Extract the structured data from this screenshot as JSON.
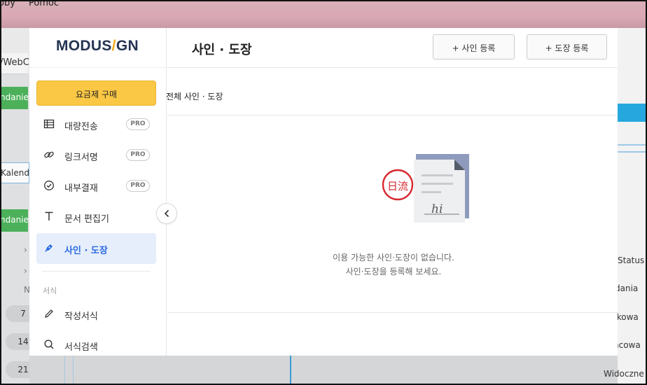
{
  "background": {
    "menu_items": [
      "oby",
      "Pomoc"
    ],
    "url_fragment": "/WebC",
    "left_tabs": [
      "ndanie",
      "ndanie"
    ],
    "calendar_label": "Kalenda",
    "pills": [
      "7",
      "14",
      "21"
    ],
    "right_texts": [
      "Status",
      "dania",
      "tkowa",
      "ńcowa",
      "Widoczne"
    ],
    "left_section_letter": "N"
  },
  "app": {
    "logo": {
      "part1": "MODUS",
      "slash": "/",
      "part2": "GN"
    },
    "sidebar": {
      "plan_button": "요금제 구매",
      "items": [
        {
          "label": "대량전송",
          "icon": "table-icon",
          "badge": "PRO"
        },
        {
          "label": "링크서명",
          "icon": "link-icon",
          "badge": "PRO"
        },
        {
          "label": "내부결재",
          "icon": "check-circle-icon",
          "badge": "PRO"
        },
        {
          "label": "문서 편집기",
          "icon": "text-icon"
        },
        {
          "label": "사인 · 도장",
          "icon": "pen-nib-icon",
          "active": true
        },
        {
          "label": "작성서식",
          "icon": "pencil-icon"
        },
        {
          "label": "서식검색",
          "icon": "search-icon"
        }
      ],
      "section_label": "서식"
    },
    "header": {
      "title": "사인 · 도장",
      "add_sign_button": "+ 사인 등록",
      "add_stamp_button": "+ 도장 등록"
    },
    "filter_label": "전체 사인 · 도장",
    "empty_state": {
      "line1": "이용 가능한 사인·도장이 없습니다.",
      "line2": "사인·도장을 등록해 보세요.",
      "illustration_stamp_text": "日流",
      "illustration_sign_text": "hi"
    },
    "colors": {
      "accent": "#2b6bdf",
      "plan_button": "#fbc845",
      "logo": "#253452",
      "logo_slash": "#f2a81d",
      "stamp": "#d7262e"
    }
  }
}
